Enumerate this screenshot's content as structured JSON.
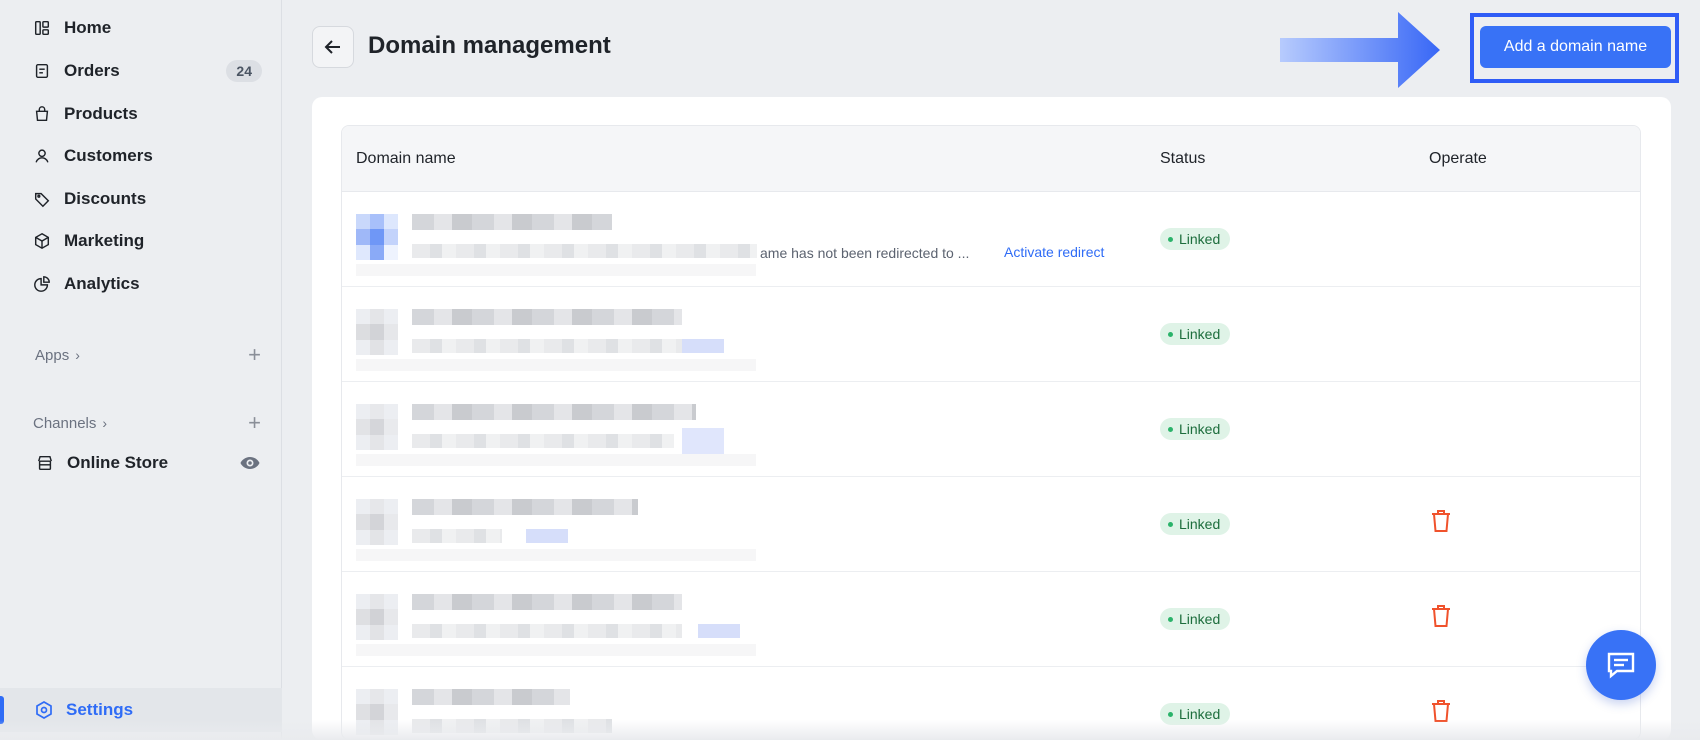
{
  "sidebar": {
    "items": [
      {
        "label": "Home",
        "icon": "home-icon"
      },
      {
        "label": "Orders",
        "icon": "orders-icon",
        "badge": "24"
      },
      {
        "label": "Products",
        "icon": "bag-icon"
      },
      {
        "label": "Customers",
        "icon": "person-icon"
      },
      {
        "label": "Discounts",
        "icon": "tag-icon"
      },
      {
        "label": "Marketing",
        "icon": "cube-icon"
      },
      {
        "label": "Analytics",
        "icon": "pie-chart-icon"
      }
    ],
    "apps_label": "Apps",
    "channels_label": "Channels",
    "online_store_label": "Online Store",
    "settings_label": "Settings"
  },
  "header": {
    "title": "Domain management",
    "add_button_label": "Add a domain name"
  },
  "table": {
    "columns": [
      "Domain name",
      "Status",
      "Operate"
    ],
    "rows": [
      {
        "note": "ame has not been redirected to ...",
        "action_link": "Activate redirect",
        "status": "Linked",
        "deletable": false
      },
      {
        "note": "",
        "action_link": "",
        "status": "Linked",
        "deletable": false
      },
      {
        "note": "",
        "action_link": "",
        "status": "Linked",
        "deletable": false
      },
      {
        "note": "",
        "action_link": "",
        "status": "Linked",
        "deletable": true
      },
      {
        "note": "",
        "action_link": "",
        "status": "Linked",
        "deletable": true
      },
      {
        "note": "",
        "action_link": "",
        "status": "Linked",
        "deletable": true
      }
    ]
  },
  "colors": {
    "accent": "#3872f6",
    "status_bg": "#dff3e7",
    "status_text": "#1c6d3c",
    "danger": "#f0522c"
  }
}
